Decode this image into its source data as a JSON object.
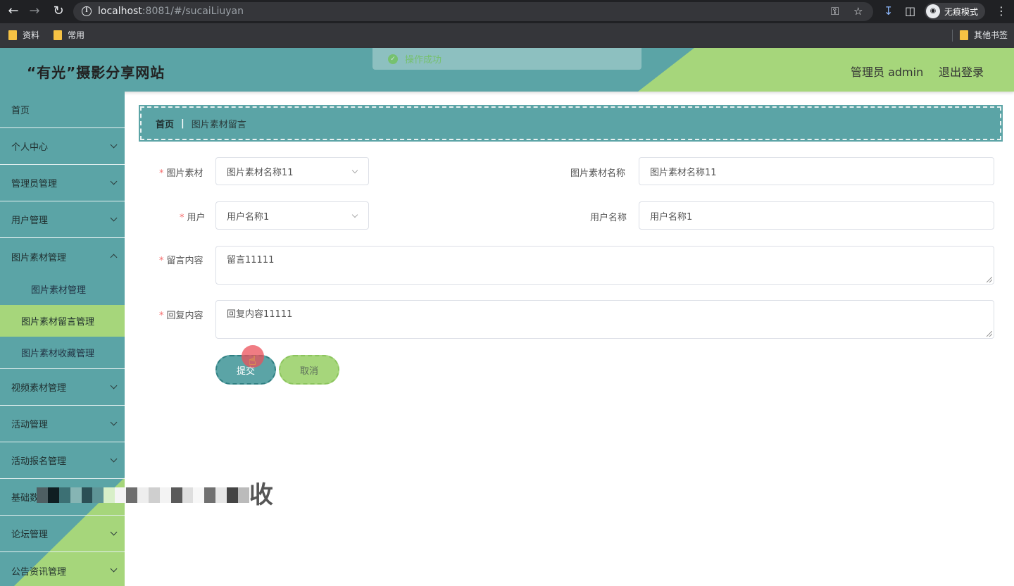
{
  "browser": {
    "url_host": "localhost",
    "url_rest": ":8081/#/sucaiLiuyan",
    "incognito_label": "无痕模式",
    "bookmarks": [
      "资料",
      "常用"
    ],
    "other_bookmarks": "其他书签"
  },
  "header": {
    "site_title": "“有光”摄影分享网站",
    "user_label": "管理员 admin",
    "logout_label": "退出登录",
    "toast_text": "操作成功"
  },
  "sidebar": {
    "items": [
      {
        "label": "首页"
      },
      {
        "label": "个人中心"
      },
      {
        "label": "管理员管理"
      },
      {
        "label": "用户管理"
      },
      {
        "label": "图片素材管理"
      },
      {
        "label": "视频素材管理"
      },
      {
        "label": "活动管理"
      },
      {
        "label": "活动报名管理"
      },
      {
        "label": "基础数"
      },
      {
        "label": "论坛管理"
      },
      {
        "label": "公告资讯管理"
      }
    ],
    "sub_items": [
      {
        "label": "图片素材管理"
      },
      {
        "label": "图片素材留言管理"
      },
      {
        "label": "图片素材收藏管理"
      }
    ],
    "overlay_fragment": "收"
  },
  "breadcrumb": {
    "home": "首页",
    "separator": "|",
    "current": "图片素材留言"
  },
  "form": {
    "picture": {
      "label": "图片素材",
      "value": "图片素材名称11"
    },
    "picture_name": {
      "label": "图片素材名称",
      "value": "图片素材名称11"
    },
    "user": {
      "label": "用户",
      "value": "用户名称1"
    },
    "user_name": {
      "label": "用户名称",
      "value": "用户名称1"
    },
    "message": {
      "label": "留言内容",
      "value": "留言11111"
    },
    "reply": {
      "label": "回复内容",
      "value": "回复内容11111"
    },
    "required_mark": "*",
    "submit_label": "提交",
    "cancel_label": "取消"
  },
  "colors": {
    "primary": "#5ba4a6",
    "accent": "#a6d67b",
    "required": "#f56c6c",
    "success": "#67c23a"
  }
}
